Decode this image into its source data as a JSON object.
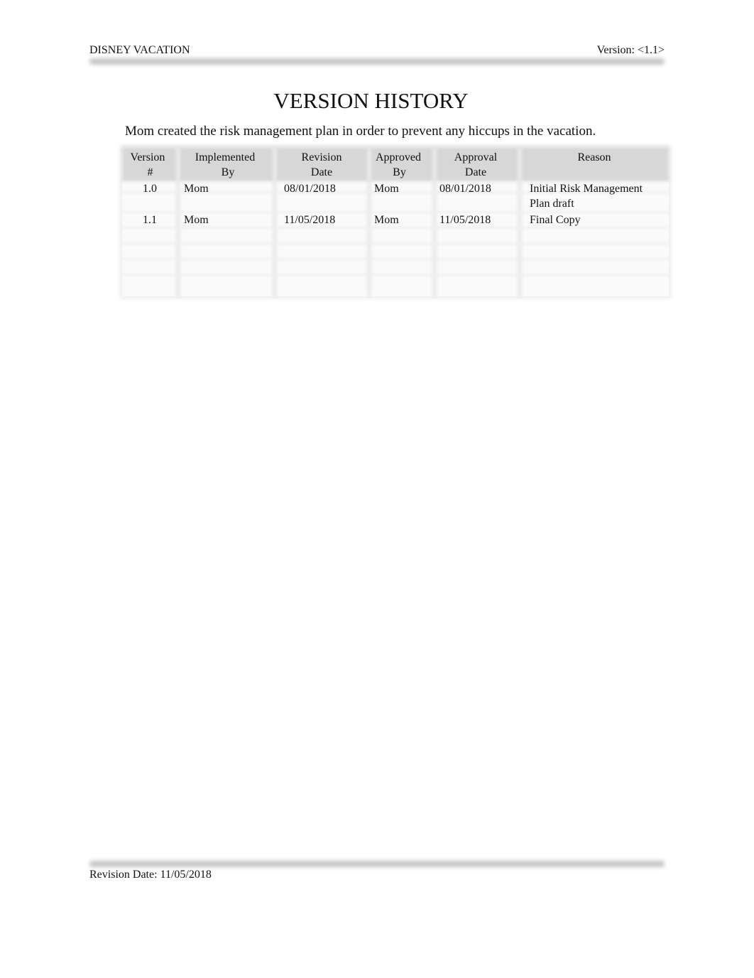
{
  "header": {
    "left": "DISNEY VACATION",
    "right": "Version:  <1.1>"
  },
  "title": "VERSION HISTORY",
  "intro": "Mom created the risk management plan in order to prevent any hiccups in the vacation.",
  "table": {
    "headers": [
      {
        "line1": "Version",
        "line2": "#"
      },
      {
        "line1": "Implemented",
        "line2": "By"
      },
      {
        "line1": "Revision",
        "line2": "Date"
      },
      {
        "line1": "Approved",
        "line2": "By"
      },
      {
        "line1": "Approval",
        "line2": "Date"
      },
      {
        "line1": "Reason",
        "line2": ""
      }
    ],
    "rows": [
      {
        "version": "1.0",
        "implemented_by": "Mom",
        "revision_date": "08/01/2018",
        "approved_by": "Mom",
        "approval_date": "08/01/2018",
        "reason": "Initial Risk Management Plan draft",
        "reason_line1": "Initial Risk Management",
        "reason_line2": "Plan draft"
      },
      {
        "version": "1.1",
        "implemented_by": "Mom",
        "revision_date": "11/05/2018",
        "approved_by": "Mom",
        "approval_date": "11/05/2018",
        "reason": "Final Copy",
        "reason_line1": "Final Copy",
        "reason_line2": ""
      }
    ]
  },
  "footer": {
    "revision": "Revision Date: 11/05/2018"
  }
}
